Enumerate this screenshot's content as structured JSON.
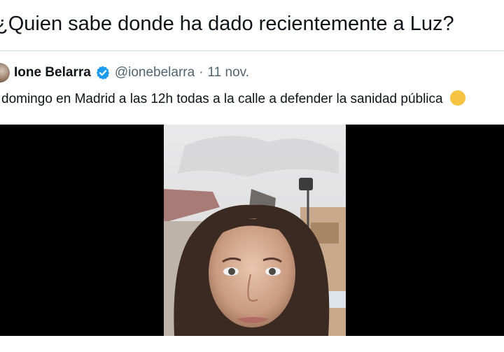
{
  "tweet": {
    "text": "¿Quien sabe donde ha dado recientemente a Luz?"
  },
  "quoted": {
    "author_name": "Ione Belarra",
    "handle": "@ionebelarra",
    "separator": "·",
    "date": "11 nov.",
    "text": "domingo en Madrid a las 12h todas a la calle a defender la sanidad pública",
    "verified_icon": "verified-badge-icon",
    "colors": {
      "verified": "#1d9bf0",
      "muted": "#536471",
      "text": "#0f1419"
    }
  },
  "video": {
    "letterbox_color": "#000000"
  }
}
